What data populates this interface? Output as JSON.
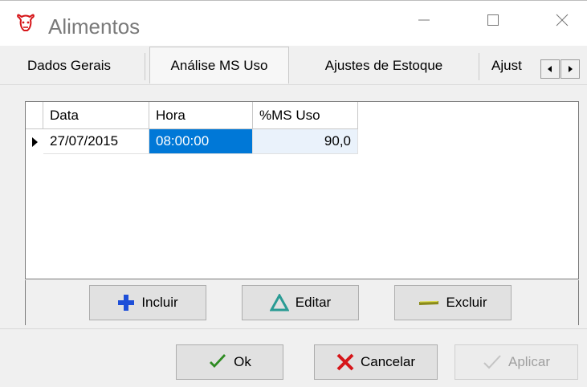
{
  "window": {
    "title": "Alimentos",
    "icon": "cow-icon",
    "controls": [
      "minimize-icon",
      "maximize-icon",
      "close-icon"
    ]
  },
  "tabs": [
    {
      "label": "Dados Gerais",
      "active": false
    },
    {
      "label": "Análise MS Uso",
      "active": true
    },
    {
      "label": "Ajustes de Estoque",
      "active": false
    },
    {
      "label": "Ajust",
      "active": false
    }
  ],
  "grid": {
    "columns": [
      "Data",
      "Hora",
      "%MS Uso"
    ],
    "rows": [
      {
        "data": "27/07/2015",
        "hora": "08:00:00",
        "ms_uso": "90,0"
      }
    ]
  },
  "grid_buttons": {
    "incluir": {
      "label": "Incluir",
      "icon": "plus-icon"
    },
    "editar": {
      "label": "Editar",
      "icon": "triangle-icon"
    },
    "excluir": {
      "label": "Excluir",
      "icon": "minus-icon"
    }
  },
  "dialog_buttons": {
    "ok": {
      "label": "Ok",
      "icon": "checkmark-icon"
    },
    "cancelar": {
      "label": "Cancelar",
      "icon": "x-mark-icon"
    },
    "aplicar": {
      "label": "Aplicar",
      "icon": "checkmark-disabled-icon",
      "disabled": true
    }
  },
  "colors": {
    "selection": "#0078d7",
    "title_text": "#7a7a7a",
    "plus_blue": "#1e4fd8",
    "triangle_teal": "#2a9b94",
    "minus_olive": "#8a8a1a",
    "check_green": "#2e8b22",
    "x_red": "#d6161a"
  }
}
